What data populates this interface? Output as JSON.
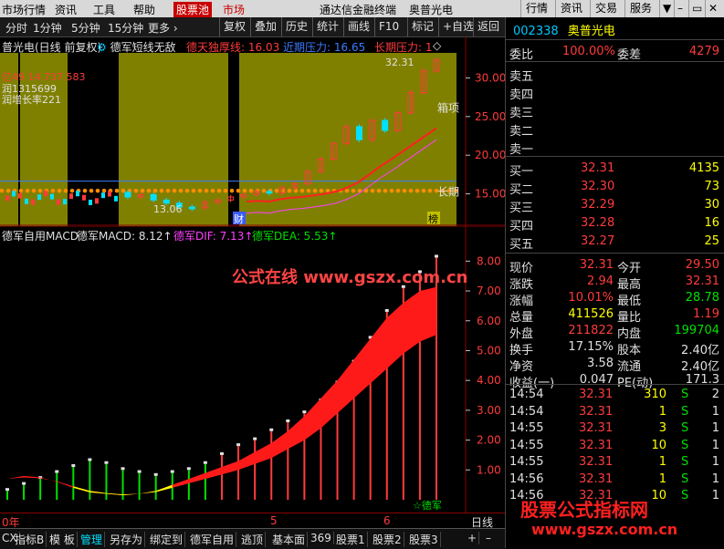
{
  "menubar": {
    "items": [
      "市场行情",
      "资讯",
      "工具",
      "帮助",
      "股票池",
      "市场"
    ],
    "title": "通达信金融终端",
    "stock_name": "奥普光电",
    "right_buttons": [
      "行情",
      "资讯",
      "交易",
      "服务"
    ],
    "window_controls": [
      "▼",
      "–",
      "▭",
      "✕"
    ]
  },
  "toolbar": {
    "periods": [
      "分时",
      "1分钟",
      "5分钟",
      "15分钟",
      "更多 ›"
    ],
    "buttons": [
      "复权",
      "叠加",
      "历史",
      "统计",
      "画线",
      "F10",
      "标记",
      "+自选",
      "返回"
    ]
  },
  "price_panel": {
    "title": "普光电(日线 前复权)",
    "indicator": "德军短线无敌",
    "legend": [
      {
        "text": "德天独厚线: 16.03",
        "color": "#ff3b3b"
      },
      {
        "text": "近期压力: 16.65",
        "color": "#3b7bff"
      },
      {
        "text": "长期压力: 1",
        "color": "#ff3b3b"
      }
    ],
    "left_info": [
      "亿49 14.737.583",
      "润1315699",
      "润增长率221"
    ],
    "annotations": {
      "high": "32.31",
      "low": "13.06",
      "box": "箱项",
      "long": "长期",
      "cai": "财",
      "bang": "榜"
    },
    "y_ticks": [
      "30.00",
      "25.00",
      "20.00",
      "15.00"
    ]
  },
  "macd_panel": {
    "title": "德军自用MACD",
    "legend": [
      {
        "text": "德军MACD: 8.12↑",
        "color": "#e0e0e0"
      },
      {
        "text": "德军DIF: 7.13↑",
        "color": "#ff40ff"
      },
      {
        "text": "德军DEA: 5.53↑",
        "color": "#00e000"
      }
    ],
    "y_ticks": [
      "8.00",
      "7.00",
      "6.00",
      "5.00",
      "4.00",
      "3.00",
      "2.00",
      "1.00"
    ],
    "note": "☆德军",
    "watermark": "公式在线 www.gszx.com.cn"
  },
  "chart_data": [
    {
      "type": "line",
      "title": "普光电(日线 前复权)",
      "ylim": [
        12,
        33
      ],
      "x_labels": [
        "财",
        "榜"
      ],
      "series": [
        {
          "name": "德天独厚线",
          "values": [
            14.0,
            14.1,
            14.0,
            14.3,
            14.5,
            14.6,
            14.8,
            15.0,
            15.3,
            15.8,
            16.5,
            17.5,
            18.6,
            19.5,
            20.5,
            21.5,
            22.5,
            23.5
          ]
        },
        {
          "name": "近期压力",
          "values": [
            16.65,
            16.65,
            16.65,
            16.65,
            16.65,
            16.65,
            16.65,
            16.65,
            16.65,
            16.65,
            16.65,
            16.65,
            16.65,
            16.65,
            16.65,
            16.65,
            16.65,
            16.65
          ]
        }
      ],
      "candles": [
        {
          "o": 15.2,
          "c": 14.6
        },
        {
          "o": 14.6,
          "c": 14.9
        },
        {
          "o": 14.9,
          "c": 14.2
        },
        {
          "o": 14.2,
          "c": 13.8
        },
        {
          "o": 13.8,
          "c": 13.3
        },
        {
          "o": 13.3,
          "c": 13.06
        },
        {
          "o": 13.2,
          "c": 13.9
        },
        {
          "o": 13.9,
          "c": 14.2
        },
        {
          "o": 14.2,
          "c": 14.6
        },
        {
          "o": 14.6,
          "c": 14.9
        },
        {
          "o": 14.9,
          "c": 15.3
        },
        {
          "o": 15.3,
          "c": 15.1
        },
        {
          "o": 15.1,
          "c": 15.8
        },
        {
          "o": 15.8,
          "c": 16.3
        },
        {
          "o": 16.3,
          "c": 17.9
        },
        {
          "o": 17.9,
          "c": 19.5
        },
        {
          "o": 19.5,
          "c": 21.5
        },
        {
          "o": 21.5,
          "c": 23.7
        },
        {
          "o": 23.7,
          "c": 22.0
        },
        {
          "o": 22.0,
          "c": 24.5
        },
        {
          "o": 24.5,
          "c": 23.2
        },
        {
          "o": 23.2,
          "c": 25.5
        },
        {
          "o": 25.5,
          "c": 28.1
        },
        {
          "o": 28.1,
          "c": 30.9
        },
        {
          "o": 30.9,
          "c": 32.31
        }
      ]
    },
    {
      "type": "bar",
      "title": "德军自用MACD",
      "ylim": [
        0,
        8.5
      ],
      "series": [
        {
          "name": "德军MACD",
          "values": [
            0.3,
            0.5,
            0.7,
            0.9,
            1.1,
            1.3,
            1.2,
            1.0,
            0.9,
            0.8,
            0.9,
            1.0,
            1.2,
            1.5,
            1.8,
            2.0,
            2.3,
            2.6,
            2.9,
            3.3,
            3.9,
            4.6,
            5.4,
            6.3,
            7.1,
            7.6,
            8.12
          ]
        },
        {
          "name": "德军DIF",
          "values": [
            0.7,
            0.8,
            0.75,
            0.6,
            0.4,
            0.25,
            0.2,
            0.15,
            0.2,
            0.3,
            0.5,
            0.7,
            0.9,
            1.1,
            1.3,
            1.6,
            1.9,
            2.3,
            2.8,
            3.4,
            4.0,
            4.7,
            5.4,
            6.1,
            6.6,
            7.0,
            7.13
          ]
        },
        {
          "name": "德军DEA",
          "values": [
            0.7,
            0.75,
            0.72,
            0.62,
            0.45,
            0.3,
            0.22,
            0.18,
            0.2,
            0.26,
            0.4,
            0.55,
            0.7,
            0.85,
            1.0,
            1.2,
            1.4,
            1.7,
            2.0,
            2.4,
            2.9,
            3.4,
            3.9,
            4.4,
            4.9,
            5.3,
            5.53
          ]
        }
      ]
    }
  ],
  "right_panel": {
    "code": "002338",
    "name": "奥普光电",
    "weibi": {
      "label": "委比",
      "value": "100.00%",
      "label2": "委差",
      "value2": "4279"
    },
    "sell": [
      {
        "label": "卖五",
        "price": "",
        "vol": ""
      },
      {
        "label": "卖四",
        "price": "",
        "vol": ""
      },
      {
        "label": "卖三",
        "price": "",
        "vol": ""
      },
      {
        "label": "卖二",
        "price": "",
        "vol": ""
      },
      {
        "label": "卖一",
        "price": "",
        "vol": ""
      }
    ],
    "buy": [
      {
        "label": "买一",
        "price": "32.31",
        "vol": "4135"
      },
      {
        "label": "买二",
        "price": "32.30",
        "vol": "73"
      },
      {
        "label": "买三",
        "price": "32.29",
        "vol": "30"
      },
      {
        "label": "买四",
        "price": "32.28",
        "vol": "16"
      },
      {
        "label": "买五",
        "price": "32.27",
        "vol": "25"
      }
    ],
    "quote": [
      {
        "l1": "现价",
        "v1": "32.31",
        "l2": "今开",
        "v2": "29.50"
      },
      {
        "l1": "涨跌",
        "v1": "2.94",
        "l2": "最高",
        "v2": "32.31"
      },
      {
        "l1": "涨幅",
        "v1": "10.01%",
        "l2": "最低",
        "v2": "28.78"
      },
      {
        "l1": "总量",
        "v1": "411526",
        "l2": "量比",
        "v2": "1.19"
      },
      {
        "l1": "外盘",
        "v1": "211822",
        "l2": "内盘",
        "v2": "199704"
      },
      {
        "l1": "换手",
        "v1": "17.15%",
        "l2": "股本",
        "v2": "2.40亿"
      },
      {
        "l1": "净资",
        "v1": "3.58",
        "l2": "流通",
        "v2": "2.40亿"
      },
      {
        "l1": "收益(一)",
        "v1": "0.047",
        "l2": "PE(动)",
        "v2": "171.3"
      }
    ],
    "ticks": [
      {
        "t": "14:54",
        "p": "32.31",
        "v": "310",
        "d": "S",
        "n": "2"
      },
      {
        "t": "14:54",
        "p": "32.31",
        "v": "1",
        "d": "S",
        "n": "1"
      },
      {
        "t": "14:55",
        "p": "32.31",
        "v": "3",
        "d": "S",
        "n": "1"
      },
      {
        "t": "14:55",
        "p": "32.31",
        "v": "10",
        "d": "S",
        "n": "1"
      },
      {
        "t": "14:55",
        "p": "32.31",
        "v": "1",
        "d": "S",
        "n": "1"
      },
      {
        "t": "14:56",
        "p": "32.31",
        "v": "1",
        "d": "S",
        "n": "1"
      },
      {
        "t": "14:56",
        "p": "32.31",
        "v": "10",
        "d": "S",
        "n": "1"
      }
    ],
    "watermark1": "股票公式指标网",
    "watermark2": "www.gszx.com.cn"
  },
  "axis_bottom": {
    "labels": [
      "0年",
      "5",
      "6"
    ],
    "period": "日线"
  },
  "bottom_tabs": [
    "CX",
    "指标B",
    "模 板",
    "管理",
    "另存为",
    "绑定到",
    "德军自用",
    "逃顶",
    "基本面",
    "369",
    "股票1",
    "股票2",
    "股票3"
  ]
}
